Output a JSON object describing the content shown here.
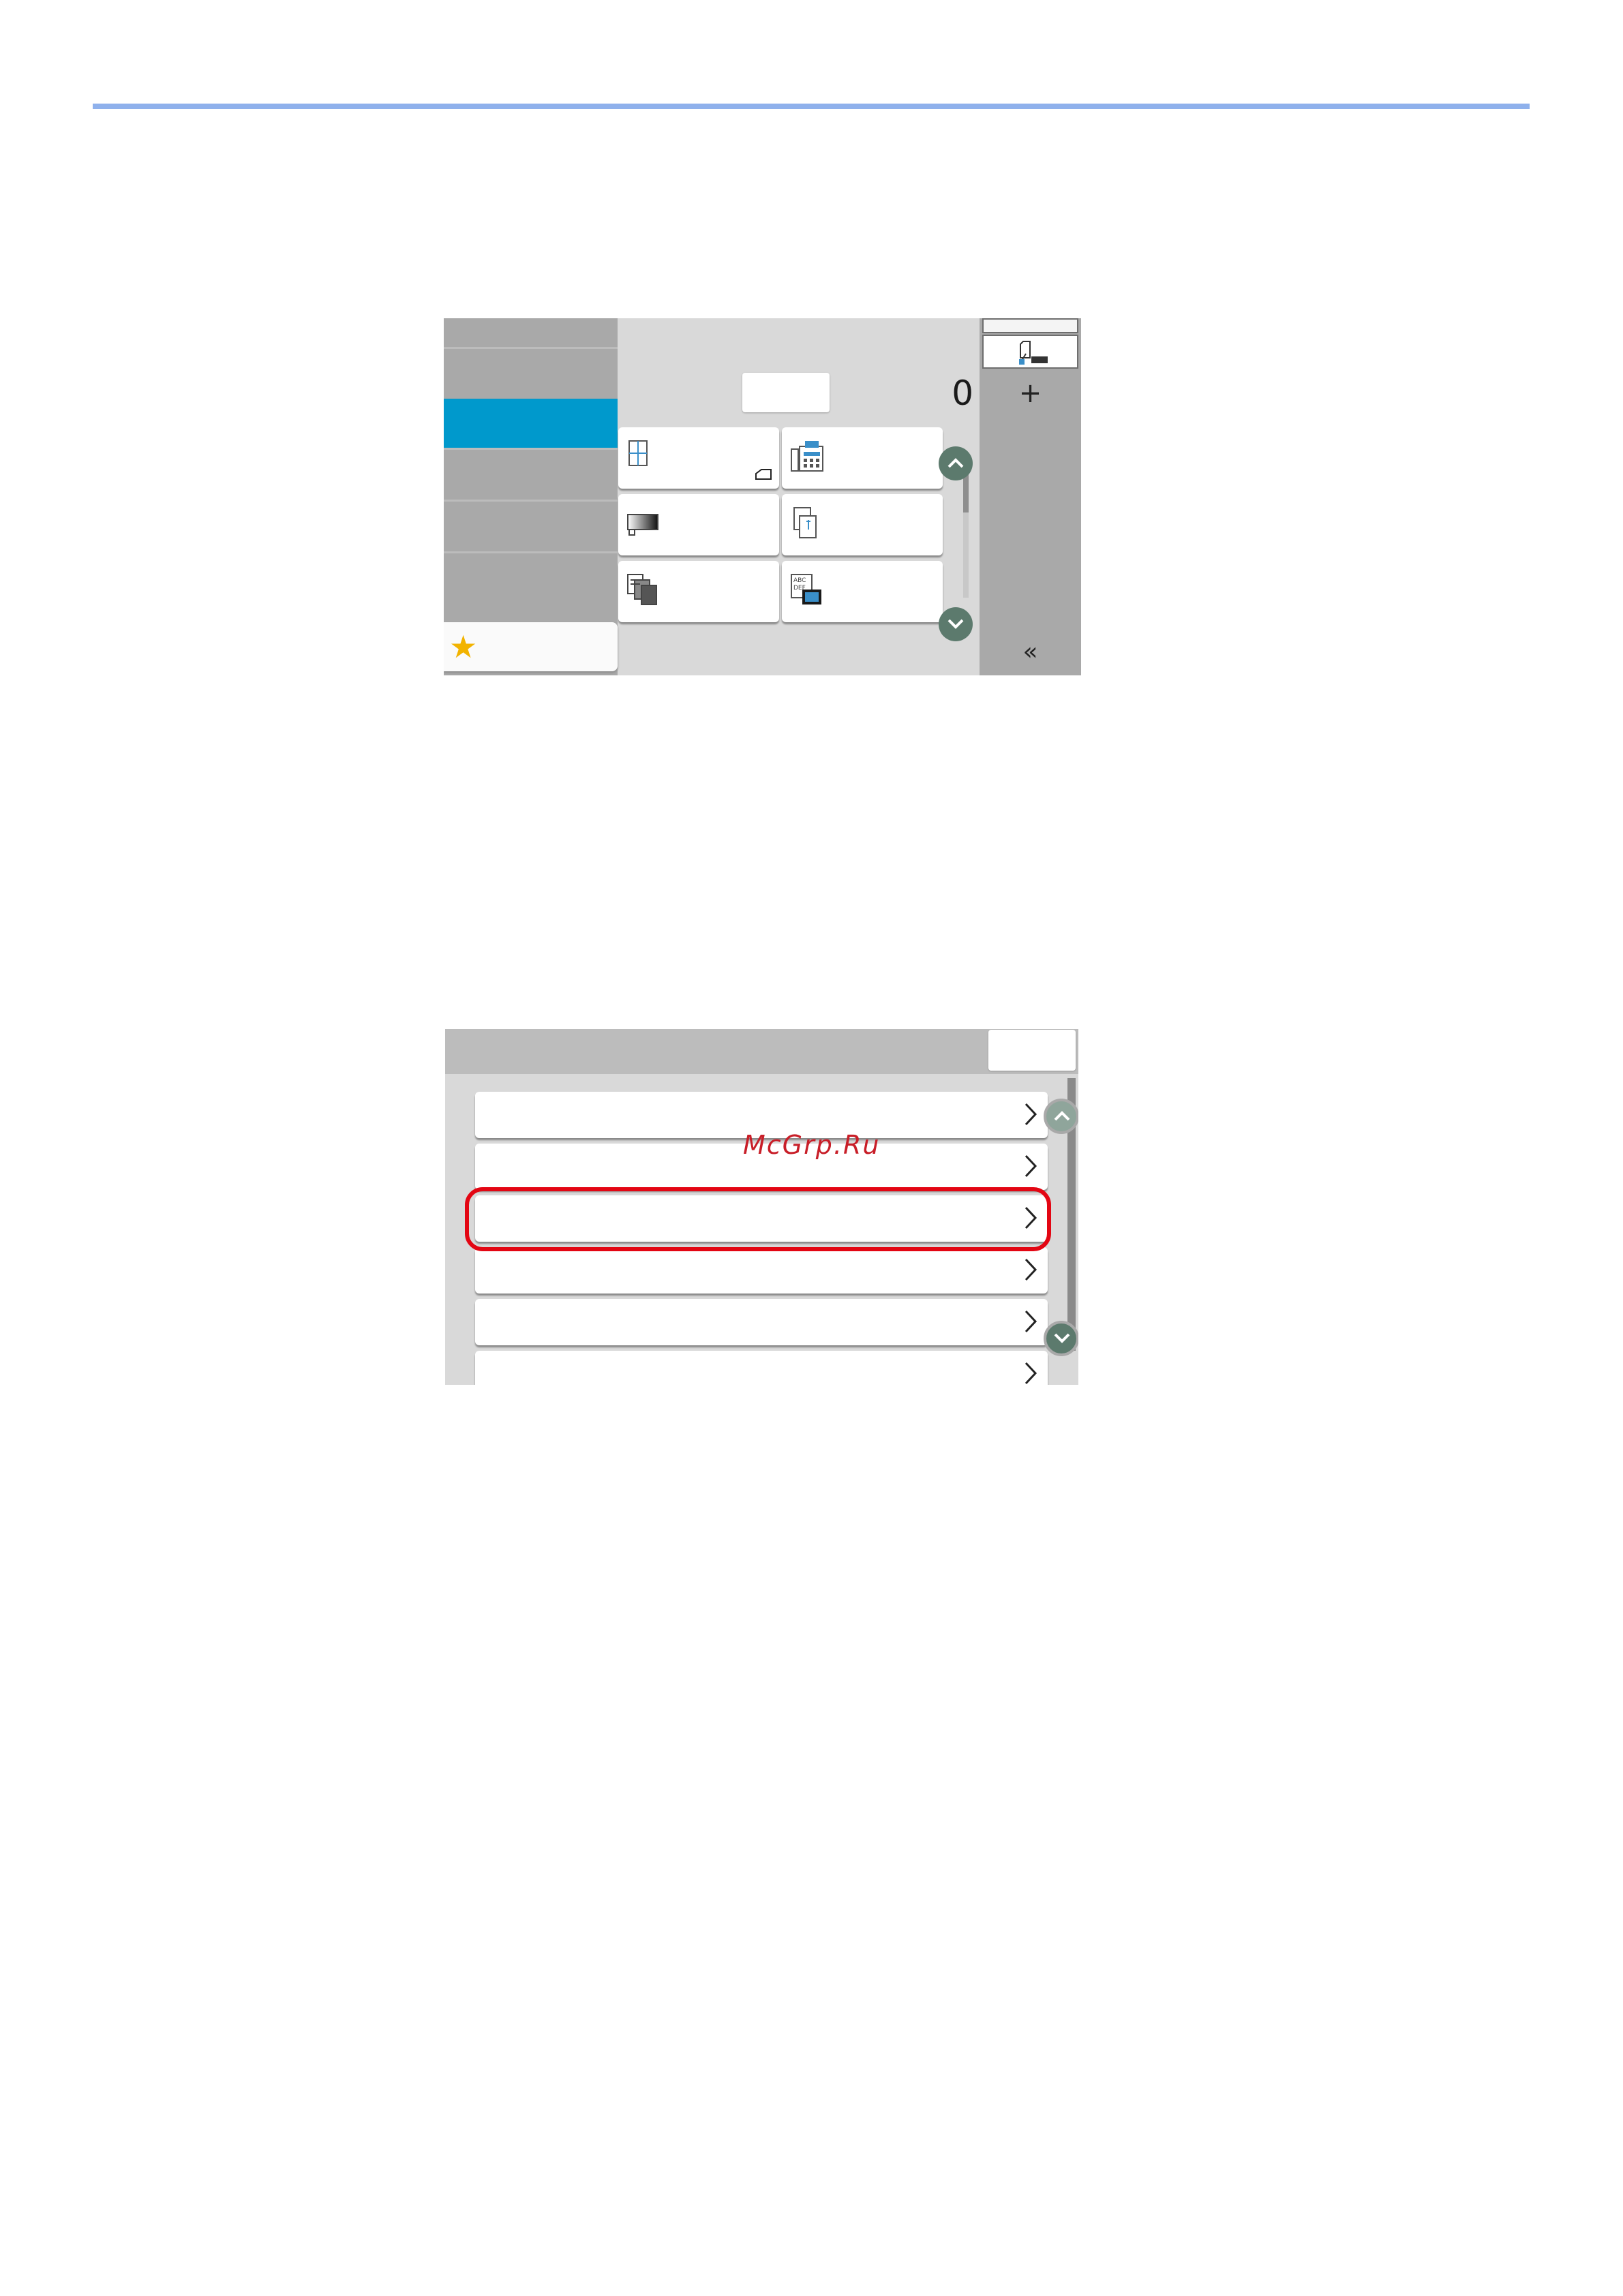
{
  "copy_screen": {
    "copy_count": "0",
    "side_tabs": [
      "",
      "",
      "",
      "",
      "",
      ""
    ],
    "selected_tab_index": 1,
    "tiles": [
      {
        "icon": "paper-selection-icon"
      },
      {
        "icon": "fax-icon"
      },
      {
        "icon": "density-icon"
      },
      {
        "icon": "duplex-icon"
      },
      {
        "icon": "collate-icon"
      },
      {
        "icon": "image-quality-icon"
      }
    ],
    "favorite_icon": "star-icon",
    "right_panel": {
      "plus_label": "+",
      "collapse_label": "«"
    }
  },
  "settings_screen": {
    "rows": [
      "",
      "",
      "",
      "",
      "",
      ""
    ],
    "highlighted_row_index": 2,
    "highlight_color": "#e30613"
  },
  "watermark": "McGrp.Ru",
  "colors": {
    "accent": "#0099cc",
    "rule": "#8fb1ec",
    "star": "#f2b300"
  }
}
